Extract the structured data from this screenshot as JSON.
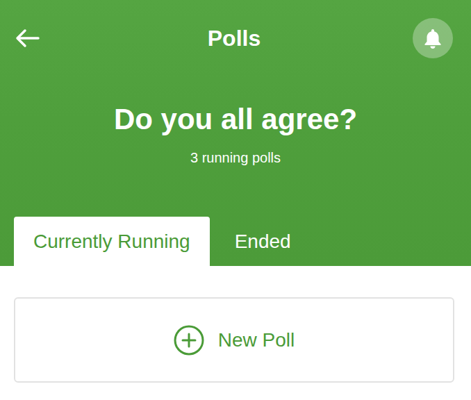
{
  "header": {
    "title": "Polls",
    "heading": "Do you all agree?",
    "subtitle": "3 running polls"
  },
  "tabs": [
    {
      "label": "Currently Running",
      "selected": true
    },
    {
      "label": "Ended",
      "selected": false
    }
  ],
  "new_poll": {
    "label": "New Poll"
  }
}
